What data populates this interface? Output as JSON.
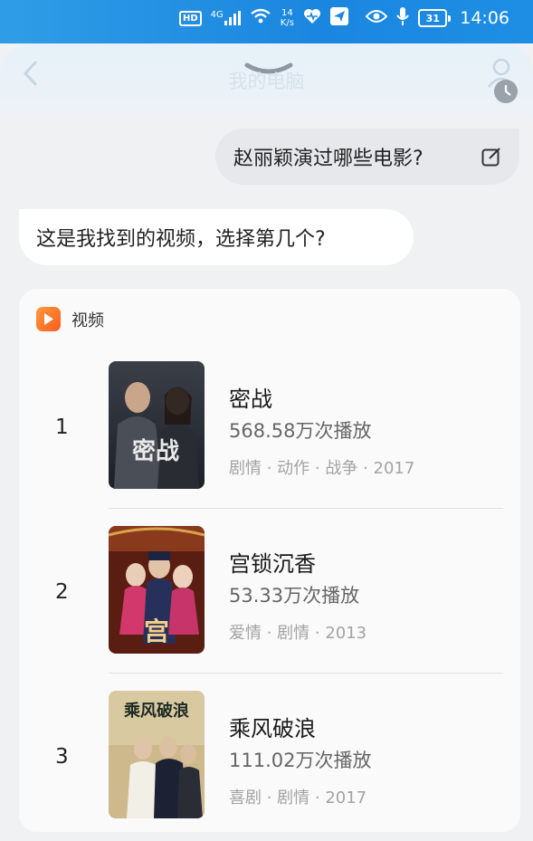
{
  "status_bar": {
    "hd": "HD",
    "network": "4G",
    "speed_value": "14",
    "speed_unit": "K/s",
    "battery": "31",
    "time": "14:06"
  },
  "header": {
    "title": "我的电脑"
  },
  "chat": {
    "user_message": "赵丽颖演过哪些电影?",
    "assistant_message": "这是我找到的视频，选择第几个?"
  },
  "video_card": {
    "title": "视频",
    "accent": "#ff6a24",
    "items": [
      {
        "index": "1",
        "title": "密战",
        "plays": "568.58万次播放",
        "tags": "剧情 · 动作 · 战争 · 2017",
        "poster_text": "密战"
      },
      {
        "index": "2",
        "title": "宫锁沉香",
        "plays": "53.33万次播放",
        "tags": "爱情 · 剧情 · 2013",
        "poster_text": "宫"
      },
      {
        "index": "3",
        "title": "乘风破浪",
        "plays": "111.02万次播放",
        "tags": "喜剧 · 剧情 · 2017",
        "poster_text": "乘风破浪"
      }
    ]
  }
}
